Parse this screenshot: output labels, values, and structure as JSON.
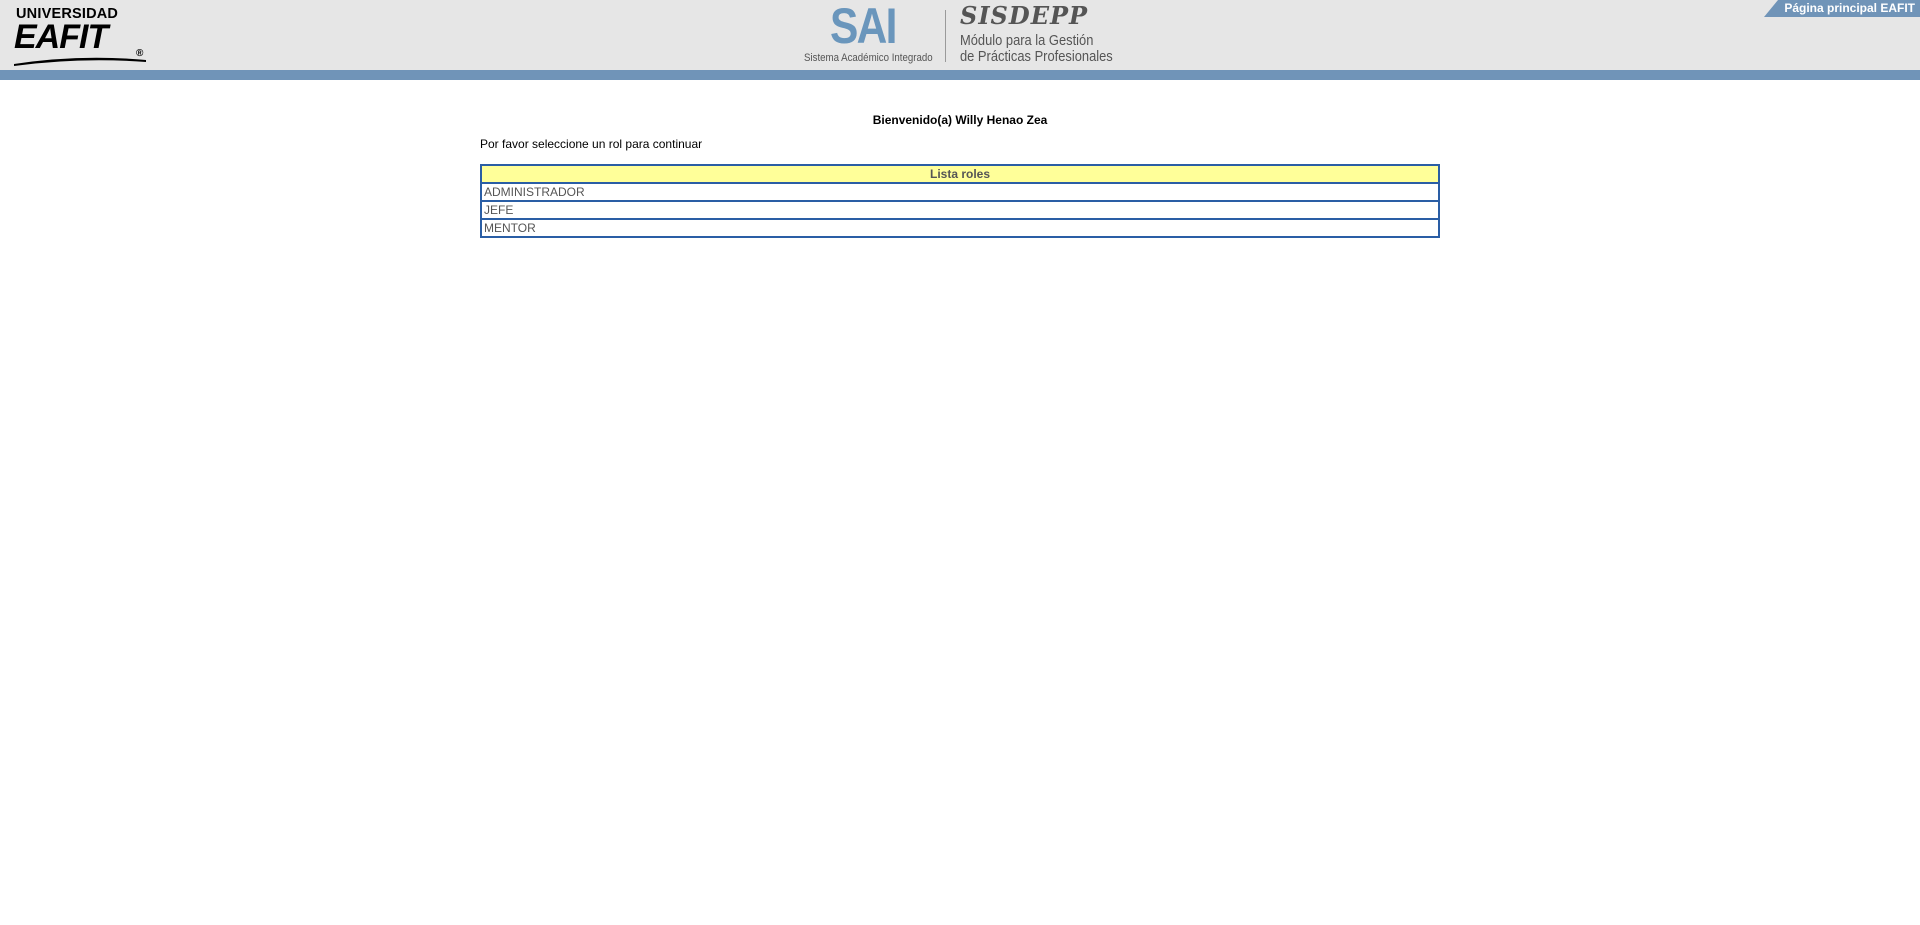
{
  "header": {
    "eafit_logo": {
      "line1": "UNIVERSIDAD",
      "line2": "EAFIT",
      "registered": "®"
    },
    "sai_logo": {
      "title": "SAI",
      "subtitle": "Sistema Académico Integrado"
    },
    "sisdepp_logo": {
      "brand": "SISDEPP",
      "line1": "Módulo para la Gestión",
      "line2": "de Prácticas Profesionales"
    },
    "home_link": "Página principal EAFIT"
  },
  "main": {
    "welcome": "Bienvenido(a) Willy Henao Zea",
    "instruction": "Por favor seleccione un rol para continuar",
    "roles_table": {
      "header": "Lista roles",
      "rows": [
        "ADMINISTRADOR",
        "JEFE",
        "MENTOR"
      ]
    }
  },
  "colors": {
    "header_bg": "#e6e6e6",
    "header_band": "#7094b8",
    "table_header_bg": "#ffff99",
    "table_border": "#2a5ea5",
    "sai_blue": "#6a96bc"
  }
}
